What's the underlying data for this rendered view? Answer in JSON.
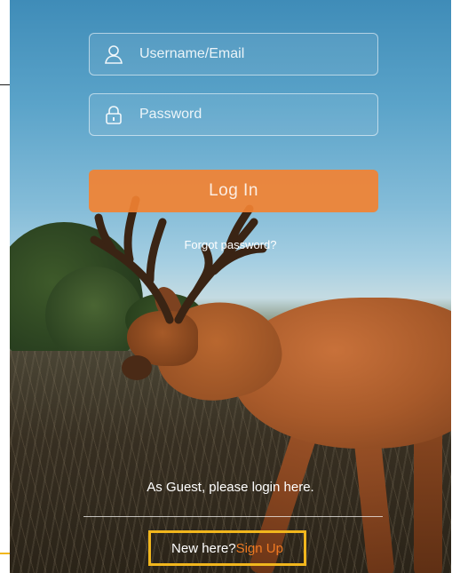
{
  "login_form": {
    "username_placeholder": "Username/Email",
    "password_placeholder": "Password",
    "login_button_label": "Log In",
    "forgot_password_link": "Forgot password?"
  },
  "footer": {
    "guest_text": "As Guest, please login here.",
    "new_here_text": "New here?",
    "signup_link": "Sign Up"
  },
  "icons": {
    "username": "user-icon",
    "password": "lock-icon"
  },
  "colors": {
    "login_button": "#F28232",
    "signup_link": "#F07A22",
    "highlight_box": "#F1B61D"
  }
}
